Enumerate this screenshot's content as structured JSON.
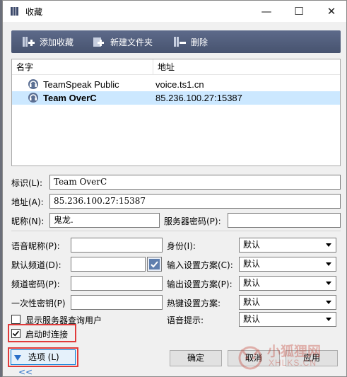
{
  "window": {
    "title": "收藏",
    "minimize": "—",
    "maximize": "☐",
    "close": "✕"
  },
  "toolbar": {
    "add_label": "添加收藏",
    "new_folder_label": "新建文件夹",
    "delete_label": "删除"
  },
  "list": {
    "col_name": "名字",
    "col_address": "地址",
    "rows": [
      {
        "name": "TeamSpeak Public",
        "address": "voice.ts1.cn",
        "selected": false
      },
      {
        "name": "Team OverC",
        "address": "85.236.100.27:15387",
        "selected": true
      }
    ]
  },
  "form": {
    "label_label": "标识(L):",
    "label_value": "Team OverC",
    "address_label": "地址(A):",
    "address_value": "85.236.100.27:15387",
    "nick_label": "昵称(N):",
    "nick_value": "鬼龙.",
    "server_pw_label": "服务器密码(P):",
    "server_pw_value": ""
  },
  "options": {
    "voice_nick_label": "语音昵称(P):",
    "default_channel_label": "默认频道(D):",
    "channel_pw_label": "频道密码(P):",
    "otp_label": "一次性密钥(P)",
    "show_server_query_label": "显示服务器查询用户",
    "identity_label": "身份(I):",
    "input_profile_label": "输入设置方案(C):",
    "output_profile_label": "输出设置方案(P):",
    "hotkey_profile_label": "热键设置方案:",
    "voice_hint_label": "语音提示:",
    "identity_value": "默认",
    "input_profile_value": "默认",
    "output_profile_value": "默认",
    "hotkey_profile_value": "默认",
    "voice_hint_value": "默认",
    "connect_on_startup_label": "启动时连接",
    "connect_on_startup_checked": true,
    "show_server_query_checked": false
  },
  "footer": {
    "options_label": "选项 (L)",
    "options_chevron": "<<",
    "ok_label": "确定",
    "cancel_label": "取消",
    "apply_label": "应用"
  },
  "watermark": {
    "text": "小狐狸网",
    "sub": "XHLKS.CN"
  },
  "colors": {
    "toolbar": "#4f5b78",
    "selection": "#cce8ff",
    "highlight_box": "#e03a3a"
  }
}
